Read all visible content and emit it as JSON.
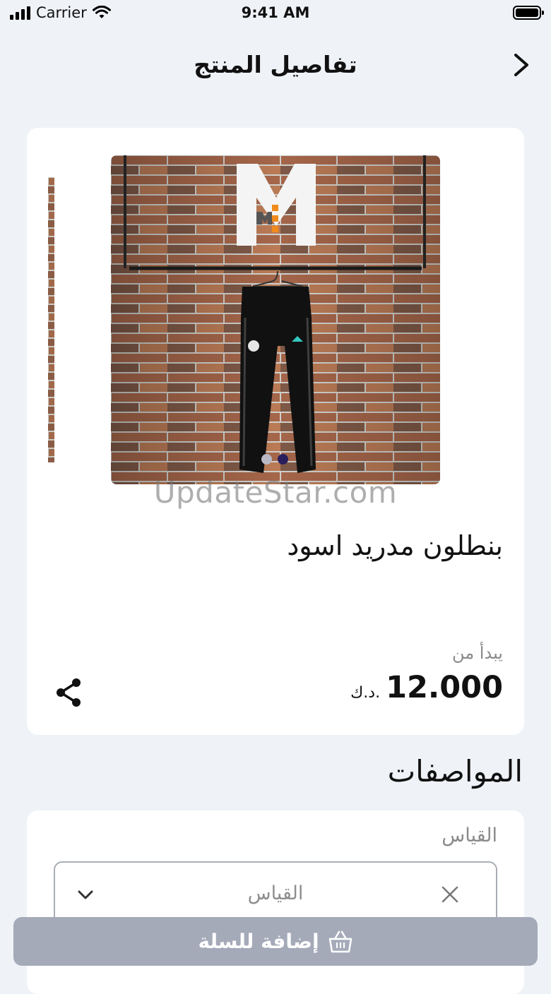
{
  "status_bar": {
    "carrier": "Carrier",
    "time": "9:41 AM"
  },
  "header": {
    "title": "تفاصيل المنتج"
  },
  "product": {
    "image_description_icon": "product-photo",
    "carousel": {
      "total_dots": 2,
      "active_dot": 2
    },
    "watermark": "UpdateStar.com",
    "name": "بنطلون مدريد اسود",
    "price_from_label": "يبدأ من",
    "price_value": "12.000",
    "currency": "د.ك."
  },
  "specs": {
    "title": "المواصفات",
    "size_label": "القياس",
    "size_placeholder": "القياس"
  },
  "cart": {
    "button_label": "إضافة للسلة"
  },
  "colors": {
    "background": "#eff2f7",
    "card": "#ffffff",
    "button_disabled": "#a5aab9",
    "dot_active": "#2a1f5c",
    "dot_inactive": "#b9b9c6"
  }
}
